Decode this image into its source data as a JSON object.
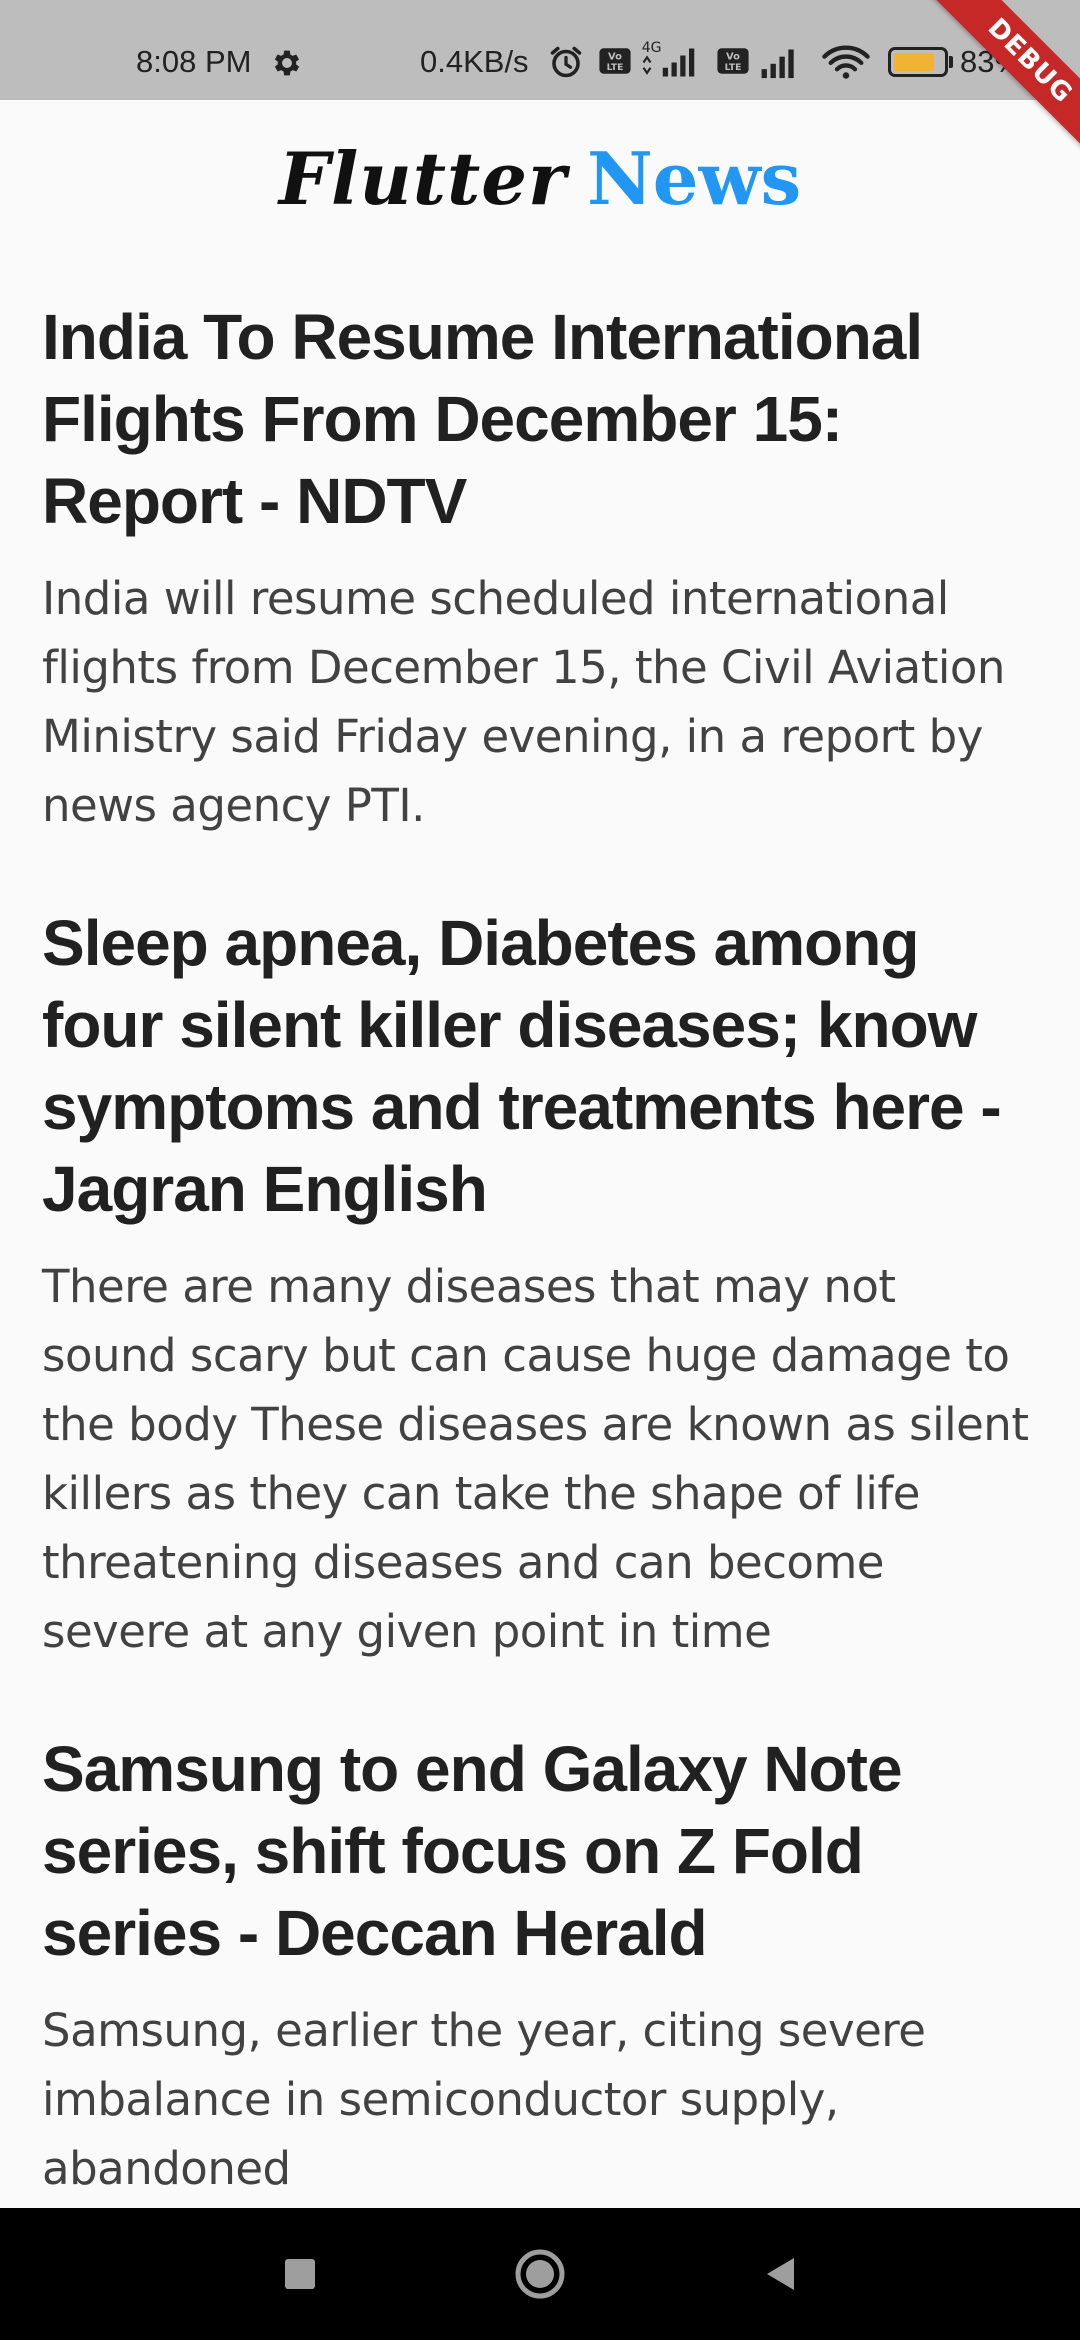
{
  "status_bar": {
    "time": "8:08 PM",
    "network_speed": "0.4KB/s",
    "battery_percent": "83%",
    "battery_level": 0.83,
    "icons": [
      "gear-icon",
      "alarm-icon",
      "volte-icon",
      "signal-icon",
      "wifi-icon",
      "battery-icon"
    ]
  },
  "debug_banner": {
    "label": "DEBUG"
  },
  "app_bar": {
    "title_part1": "Flutter",
    "title_part2": "News"
  },
  "articles": [
    {
      "title": "India To Resume International Flights From December 15: Report - NDTV",
      "description": "India will resume scheduled international flights from December 15, the Civil Aviation Ministry said Friday evening, in a report by news agency PTI."
    },
    {
      "title": "Sleep apnea, Diabetes among four silent killer diseases; know symptoms and treatments here - Jagran English",
      "description": "There are many diseases that may not sound scary but can cause huge damage to the body These diseases are known as  silent killers  as they can take the shape of life threatening diseases and can become severe at any given point in time"
    },
    {
      "title": "Samsung to end Galaxy Note series, shift focus on Z Fold series - Deccan Herald",
      "description": "Samsung, earlier the year, citing severe imbalance in semiconductor supply, abandoned"
    }
  ],
  "nav_bar": {
    "icons": [
      "recents-square-icon",
      "home-circle-icon",
      "back-triangle-icon"
    ]
  },
  "colors": {
    "status_bar_bg": "#bdbdbd",
    "debug_banner": "#c62828",
    "title_dark": "#111111",
    "title_accent": "#2196f3",
    "battery_fill": "#f2b233",
    "nav_bar_bg": "#000000",
    "nav_icon": "#9e9e9e"
  }
}
